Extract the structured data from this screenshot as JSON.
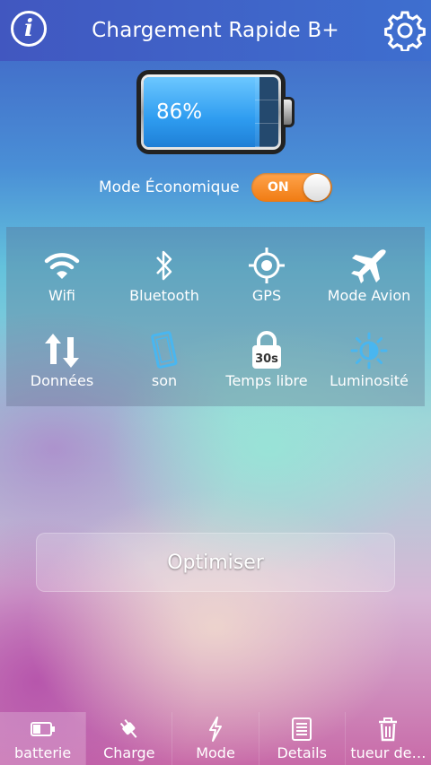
{
  "header": {
    "title": "Chargement Rapide B+",
    "info_icon": "info-icon",
    "settings_icon": "gear-icon"
  },
  "battery": {
    "percent_text": "86%",
    "level": 0.86
  },
  "eco_mode": {
    "label": "Mode Économique",
    "state": "ON"
  },
  "toggles": [
    {
      "label": "Wifi",
      "icon": "wifi-icon"
    },
    {
      "label": "Bluetooth",
      "icon": "bluetooth-icon"
    },
    {
      "label": "GPS",
      "icon": "gps-icon"
    },
    {
      "label": "Mode Avion",
      "icon": "airplane-icon"
    },
    {
      "label": "Données",
      "icon": "data-arrows-icon"
    },
    {
      "label": "son",
      "icon": "vibrate-phone-icon"
    },
    {
      "label": "Temps libre",
      "icon": "timeout-lock-icon",
      "badge": "30s"
    },
    {
      "label": "Luminosité",
      "icon": "brightness-icon"
    }
  ],
  "optimize_label": "Optimiser",
  "tabs": [
    {
      "label": "batterie",
      "icon": "battery-icon",
      "active": true
    },
    {
      "label": "Charge",
      "icon": "plug-icon"
    },
    {
      "label": "Mode",
      "icon": "lightning-icon"
    },
    {
      "label": "Details",
      "icon": "document-icon"
    },
    {
      "label": "tueur de…",
      "icon": "trash-icon"
    }
  ],
  "colors": {
    "accent_orange": "#f58a1f",
    "highlight_blue": "#49b6f0",
    "topbar": "#4162c6"
  }
}
